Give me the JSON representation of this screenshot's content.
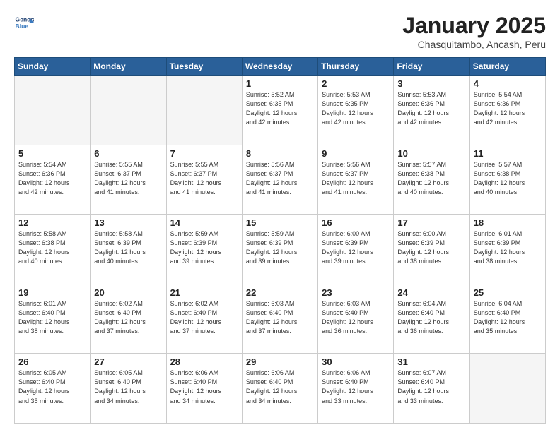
{
  "header": {
    "logo_line1": "General",
    "logo_line2": "Blue",
    "title": "January 2025",
    "subtitle": "Chasquitambo, Ancash, Peru"
  },
  "weekdays": [
    "Sunday",
    "Monday",
    "Tuesday",
    "Wednesday",
    "Thursday",
    "Friday",
    "Saturday"
  ],
  "weeks": [
    [
      {
        "day": "",
        "info": ""
      },
      {
        "day": "",
        "info": ""
      },
      {
        "day": "",
        "info": ""
      },
      {
        "day": "1",
        "info": "Sunrise: 5:52 AM\nSunset: 6:35 PM\nDaylight: 12 hours\nand 42 minutes."
      },
      {
        "day": "2",
        "info": "Sunrise: 5:53 AM\nSunset: 6:35 PM\nDaylight: 12 hours\nand 42 minutes."
      },
      {
        "day": "3",
        "info": "Sunrise: 5:53 AM\nSunset: 6:36 PM\nDaylight: 12 hours\nand 42 minutes."
      },
      {
        "day": "4",
        "info": "Sunrise: 5:54 AM\nSunset: 6:36 PM\nDaylight: 12 hours\nand 42 minutes."
      }
    ],
    [
      {
        "day": "5",
        "info": "Sunrise: 5:54 AM\nSunset: 6:36 PM\nDaylight: 12 hours\nand 42 minutes."
      },
      {
        "day": "6",
        "info": "Sunrise: 5:55 AM\nSunset: 6:37 PM\nDaylight: 12 hours\nand 41 minutes."
      },
      {
        "day": "7",
        "info": "Sunrise: 5:55 AM\nSunset: 6:37 PM\nDaylight: 12 hours\nand 41 minutes."
      },
      {
        "day": "8",
        "info": "Sunrise: 5:56 AM\nSunset: 6:37 PM\nDaylight: 12 hours\nand 41 minutes."
      },
      {
        "day": "9",
        "info": "Sunrise: 5:56 AM\nSunset: 6:37 PM\nDaylight: 12 hours\nand 41 minutes."
      },
      {
        "day": "10",
        "info": "Sunrise: 5:57 AM\nSunset: 6:38 PM\nDaylight: 12 hours\nand 40 minutes."
      },
      {
        "day": "11",
        "info": "Sunrise: 5:57 AM\nSunset: 6:38 PM\nDaylight: 12 hours\nand 40 minutes."
      }
    ],
    [
      {
        "day": "12",
        "info": "Sunrise: 5:58 AM\nSunset: 6:38 PM\nDaylight: 12 hours\nand 40 minutes."
      },
      {
        "day": "13",
        "info": "Sunrise: 5:58 AM\nSunset: 6:39 PM\nDaylight: 12 hours\nand 40 minutes."
      },
      {
        "day": "14",
        "info": "Sunrise: 5:59 AM\nSunset: 6:39 PM\nDaylight: 12 hours\nand 39 minutes."
      },
      {
        "day": "15",
        "info": "Sunrise: 5:59 AM\nSunset: 6:39 PM\nDaylight: 12 hours\nand 39 minutes."
      },
      {
        "day": "16",
        "info": "Sunrise: 6:00 AM\nSunset: 6:39 PM\nDaylight: 12 hours\nand 39 minutes."
      },
      {
        "day": "17",
        "info": "Sunrise: 6:00 AM\nSunset: 6:39 PM\nDaylight: 12 hours\nand 38 minutes."
      },
      {
        "day": "18",
        "info": "Sunrise: 6:01 AM\nSunset: 6:39 PM\nDaylight: 12 hours\nand 38 minutes."
      }
    ],
    [
      {
        "day": "19",
        "info": "Sunrise: 6:01 AM\nSunset: 6:40 PM\nDaylight: 12 hours\nand 38 minutes."
      },
      {
        "day": "20",
        "info": "Sunrise: 6:02 AM\nSunset: 6:40 PM\nDaylight: 12 hours\nand 37 minutes."
      },
      {
        "day": "21",
        "info": "Sunrise: 6:02 AM\nSunset: 6:40 PM\nDaylight: 12 hours\nand 37 minutes."
      },
      {
        "day": "22",
        "info": "Sunrise: 6:03 AM\nSunset: 6:40 PM\nDaylight: 12 hours\nand 37 minutes."
      },
      {
        "day": "23",
        "info": "Sunrise: 6:03 AM\nSunset: 6:40 PM\nDaylight: 12 hours\nand 36 minutes."
      },
      {
        "day": "24",
        "info": "Sunrise: 6:04 AM\nSunset: 6:40 PM\nDaylight: 12 hours\nand 36 minutes."
      },
      {
        "day": "25",
        "info": "Sunrise: 6:04 AM\nSunset: 6:40 PM\nDaylight: 12 hours\nand 35 minutes."
      }
    ],
    [
      {
        "day": "26",
        "info": "Sunrise: 6:05 AM\nSunset: 6:40 PM\nDaylight: 12 hours\nand 35 minutes."
      },
      {
        "day": "27",
        "info": "Sunrise: 6:05 AM\nSunset: 6:40 PM\nDaylight: 12 hours\nand 34 minutes."
      },
      {
        "day": "28",
        "info": "Sunrise: 6:06 AM\nSunset: 6:40 PM\nDaylight: 12 hours\nand 34 minutes."
      },
      {
        "day": "29",
        "info": "Sunrise: 6:06 AM\nSunset: 6:40 PM\nDaylight: 12 hours\nand 34 minutes."
      },
      {
        "day": "30",
        "info": "Sunrise: 6:06 AM\nSunset: 6:40 PM\nDaylight: 12 hours\nand 33 minutes."
      },
      {
        "day": "31",
        "info": "Sunrise: 6:07 AM\nSunset: 6:40 PM\nDaylight: 12 hours\nand 33 minutes."
      },
      {
        "day": "",
        "info": ""
      }
    ]
  ]
}
